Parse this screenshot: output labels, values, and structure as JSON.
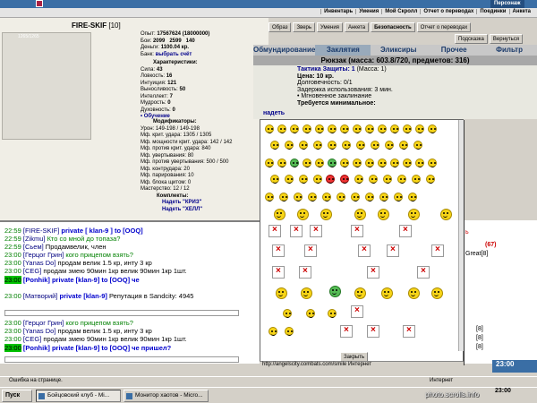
{
  "top": {
    "persona_label": "Персонаж",
    "menu": [
      "Инвентарь",
      "Умения",
      "Мой Скролл",
      "Отчет о переводах",
      "Поединки",
      "Анкета"
    ]
  },
  "character": {
    "name": "FIRE-SKIF",
    "level": "[10]",
    "hp": "1265/1265",
    "exp_label": "Опыт:",
    "exp_value": "17567624 (18000000)",
    "battles_label": "Бои:",
    "battles_value": "2099   2599   140",
    "money_label": "Деньги:",
    "money_value": "1100.04 кр.",
    "bank_label": "Банк:",
    "bank_value": "выбрать счёт",
    "attrs_title": "Характеристики:",
    "attrs": [
      {
        "label": "Сила:",
        "value": "43"
      },
      {
        "label": "Ловкость:",
        "value": "16"
      },
      {
        "label": "Интуиция:",
        "value": "121"
      },
      {
        "label": "Выносливость:",
        "value": "50"
      },
      {
        "label": "Интеллект:",
        "value": "7"
      },
      {
        "label": "Мудрость:",
        "value": "0"
      },
      {
        "label": "Духовность:",
        "value": "0"
      }
    ],
    "training": "• Обучение",
    "mods_title": "Модификаторы:",
    "mods": [
      "Урон: 149-198 / 149-198",
      "Мф. крит. удара: 1305 / 1305",
      "Мф. мощности крит. удара: 142 / 142",
      "Мф. против крит. удара: 840",
      "Мф. увертывания: 80",
      "Мф. против увертывания: 500 / 500",
      "Мф. контрудара: 20",
      "Мф. парирования: 10",
      "Мф. блока щитом: 0",
      "Мастерство: 12 / 12"
    ],
    "sets_label": "Комплекты:",
    "set1": "Надеть \"КРИЗ\"",
    "set2": "Надеть \"ХЕЛЛ\""
  },
  "actions": [
    "Образ",
    "Зверь",
    "Умения",
    "Анкета",
    "Безопасность",
    "Отчет о переводах"
  ],
  "subactions": [
    "Подсказка",
    "Вернуться"
  ],
  "inventory": {
    "tabs": [
      "Обмундирование",
      "Заклятия",
      "Эликсиры",
      "Прочее",
      "Фильтр"
    ],
    "active_tab": 1,
    "bag_title": "Рюкзак (масса: 603.8/720, предметов: 316)",
    "item_title": "Тактика Защиты: 1",
    "item_mass": "(Масса: 1)",
    "item_price": "Цена: 10 кр.",
    "item_durability": "Долговечность: 0/1",
    "item_delay": "Задержка использования: 3 мин.",
    "item_type": "• Мгновенное заклинание",
    "item_req": "Требуется минимальное:",
    "wear_label": "надеть"
  },
  "chat": {
    "messages": [
      {
        "time": "22:59",
        "nick": "[FIRE-SKIF]",
        "text": "private [ klan-9 ] to [OOQ]",
        "kind": "private"
      },
      {
        "time": "22:59",
        "nick": "[Zikmu]",
        "text": "Кто со мной до топаза?",
        "kind": "green"
      },
      {
        "time": "22:59",
        "nick": "[Сьем]",
        "text": "Продамвелик, член",
        "kind": "plain"
      },
      {
        "time": "23:00",
        "nick": "[Герцог Грин]",
        "text": "кого прицепом взять?",
        "kind": "green"
      },
      {
        "time": "23:00",
        "nick": "[Yanas Do]",
        "text": "продам велик 1.5 кр, инту 3 кр",
        "kind": "plain"
      },
      {
        "time": "23:00",
        "nick": "[CEG]",
        "text": "продам змею 90мин 1кр велик 90мин 1кр 1шт.",
        "kind": "plain"
      },
      {
        "time": "23:00",
        "nick": "[Ponhik]",
        "text": "private [klan-9] to [OOQ] че",
        "kind": "private-hl"
      },
      {
        "time": "23:00",
        "nick": "[Матвоpий]",
        "text": "private [klan-9]",
        "kind": "private-rep",
        "extra": "Репутация в Sandcity: 4945"
      },
      {
        "time": "23:00",
        "nick": "[Герцог Грин]",
        "text": "кого прицепом взять?",
        "kind": "green"
      },
      {
        "time": "23:00",
        "nick": "[Yanas Do]",
        "text": "продам велик 1.5 кр, инту 3 кр",
        "kind": "plain"
      },
      {
        "time": "23:00",
        "nick": "[CEG]",
        "text": "продам змею 90мин 1кр велик 90мин 1кр 1шт.",
        "kind": "plain"
      },
      {
        "time": "23:00",
        "nick": "[Ponhik]",
        "text": "private [klan-9] to [OOQ] че пришел?",
        "kind": "private-hl"
      }
    ]
  },
  "rightlist": [
    "ь",
    "(67)",
    "Great[8]",
    "[8]",
    "[8]",
    "[8]"
  ],
  "popup": {
    "close_label": "Закрыть",
    "status_url": "http://angelscity.combats.com/smile Интернет"
  },
  "statusbar": {
    "text": "Ошибка на странице.",
    "zone": "Интернет"
  },
  "taskbar": {
    "start": "Пуск",
    "tasks": [
      "Бойцовский клуб - Mi...",
      "Монитор хаотов - Micro..."
    ],
    "clock": "23:00",
    "watermark": "photo.scrolls.info",
    "clock_overlay": "23:00"
  }
}
